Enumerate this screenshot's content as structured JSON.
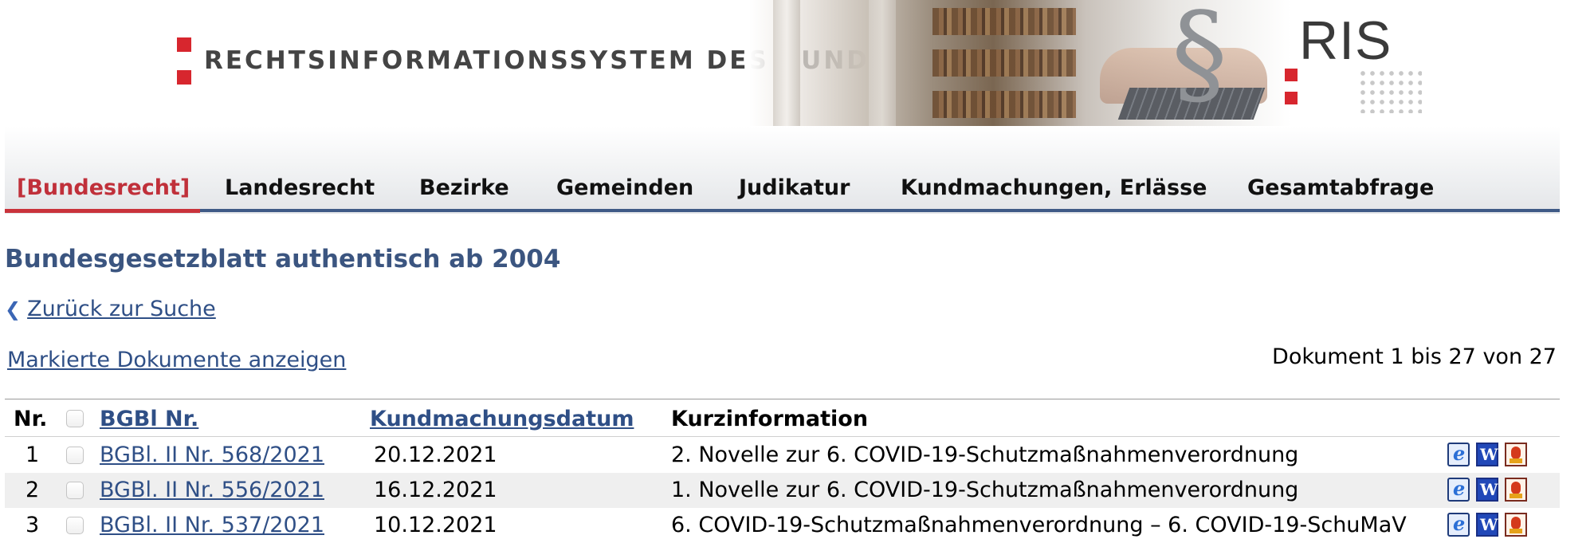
{
  "header": {
    "title": "RECHTSINFORMATIONSSYSTEM DES BUNDES",
    "logo_text": "RIS",
    "paragraph_symbol": "§"
  },
  "nav": {
    "tabs": [
      {
        "label": "[Bundesrecht]",
        "active": true
      },
      {
        "label": "Landesrecht",
        "active": false
      },
      {
        "label": "Bezirke",
        "active": false
      },
      {
        "label": "Gemeinden",
        "active": false
      },
      {
        "label": "Judikatur",
        "active": false
      },
      {
        "label": "Kundmachungen, Erlässe",
        "active": false
      },
      {
        "label": "Gesamtabfrage",
        "active": false
      }
    ]
  },
  "main": {
    "page_title": "Bundesgesetzblatt authentisch ab 2004",
    "back_link": "Zurück zur Suche",
    "marked_link": "Markierte Dokumente anzeigen",
    "doc_count": "Dokument 1 bis 27 von 27"
  },
  "table": {
    "headers": {
      "nr": "Nr.",
      "bgbl": "BGBl Nr.",
      "date": "Kundmachungsdatum",
      "info": "Kurzinformation"
    },
    "rows": [
      {
        "nr": "1",
        "bgbl": "BGBl. II Nr. 568/2021",
        "date": "20.12.2021",
        "info": "2. Novelle zur 6. COVID-19-Schutzmaßnahmenverordnung"
      },
      {
        "nr": "2",
        "bgbl": "BGBl. II Nr. 556/2021",
        "date": "16.12.2021",
        "info": "1. Novelle zur 6. COVID-19-Schutzmaßnahmenverordnung"
      },
      {
        "nr": "3",
        "bgbl": "BGBl. II Nr. 537/2021",
        "date": "10.12.2021",
        "info": "6. COVID-19-Schutzmaßnahmenverordnung – 6. COVID-19-SchuMaV"
      }
    ]
  },
  "icons": [
    "html-document-icon",
    "word-document-icon",
    "pdf-document-icon"
  ],
  "colors": {
    "brand_red": "#d7262e",
    "nav_blue": "#3f5a86",
    "title_blue": "#3b5580",
    "link_blue": "#2f4f86"
  }
}
